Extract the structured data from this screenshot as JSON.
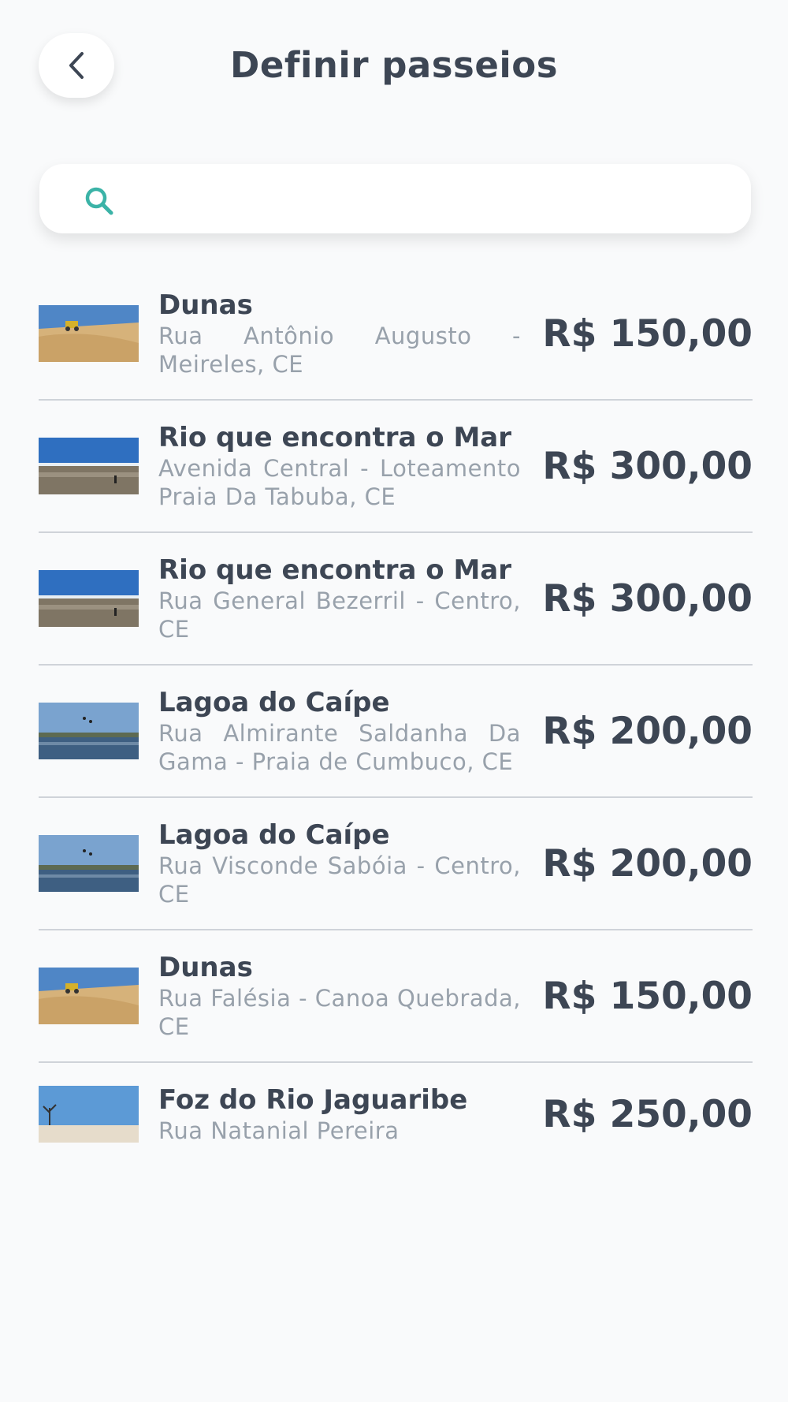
{
  "header": {
    "title": "Definir passeios",
    "back_icon": "chevron-left-icon"
  },
  "search": {
    "placeholder": "",
    "value": "",
    "icon": "search-icon",
    "icon_color": "#3bb3a7"
  },
  "tours": [
    {
      "name": "Dunas",
      "address": "Rua Antônio Augusto - Meireles, CE",
      "price": "R$ 150,00",
      "image": "dunes"
    },
    {
      "name": "Rio que encontra o Mar",
      "address": "Avenida Central - Loteamento Praia Da Tabuba, CE",
      "price": "R$ 300,00",
      "image": "river-sea"
    },
    {
      "name": "Rio que encontra o Mar",
      "address": "Rua General Bezerril - Centro, CE",
      "price": "R$ 300,00",
      "image": "river-sea"
    },
    {
      "name": "Lagoa do Caípe",
      "address": "Rua Almirante Saldanha Da Gama - Praia de Cumbuco, CE",
      "price": "R$ 200,00",
      "image": "lagoon"
    },
    {
      "name": "Lagoa do Caípe",
      "address": "Rua Visconde Sabóia - Centro, CE",
      "price": "R$ 200,00",
      "image": "lagoon"
    },
    {
      "name": "Dunas",
      "address": "Rua Falésia - Canoa Quebrada, CE",
      "price": "R$ 150,00",
      "image": "dunes"
    },
    {
      "name": "Foz do Rio Jaguaribe",
      "address": "Rua Natanial Pereira",
      "price": "R$ 250,00",
      "image": "river-mouth"
    }
  ],
  "colors": {
    "text_primary": "#3d4654",
    "text_secondary": "#98a1ab",
    "divider": "#cfd3d9",
    "accent": "#3bb3a7"
  }
}
